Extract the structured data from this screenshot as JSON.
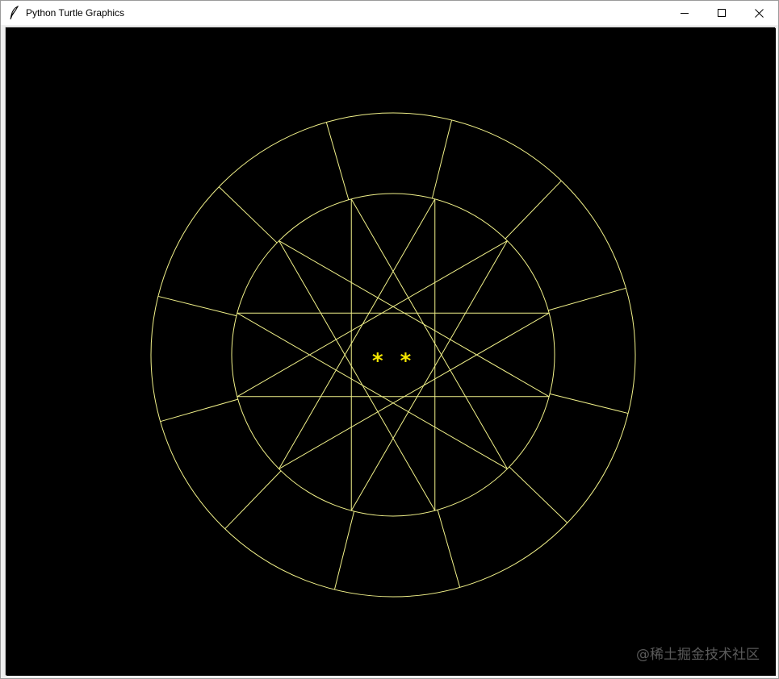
{
  "window": {
    "title": "Python Turtle Graphics",
    "icon": "feather-icon"
  },
  "controls": {
    "minimize": "minimize-icon",
    "maximize": "maximize-icon",
    "close": "close-icon"
  },
  "canvas": {
    "background": "#000000",
    "stroke_color": "#f2f28a",
    "text_color": "#f5e600",
    "center_text": "* *",
    "outer_circle_segments": 12,
    "inner_star_points": 12
  },
  "watermark": {
    "text": "@稀土掘金技术社区"
  }
}
